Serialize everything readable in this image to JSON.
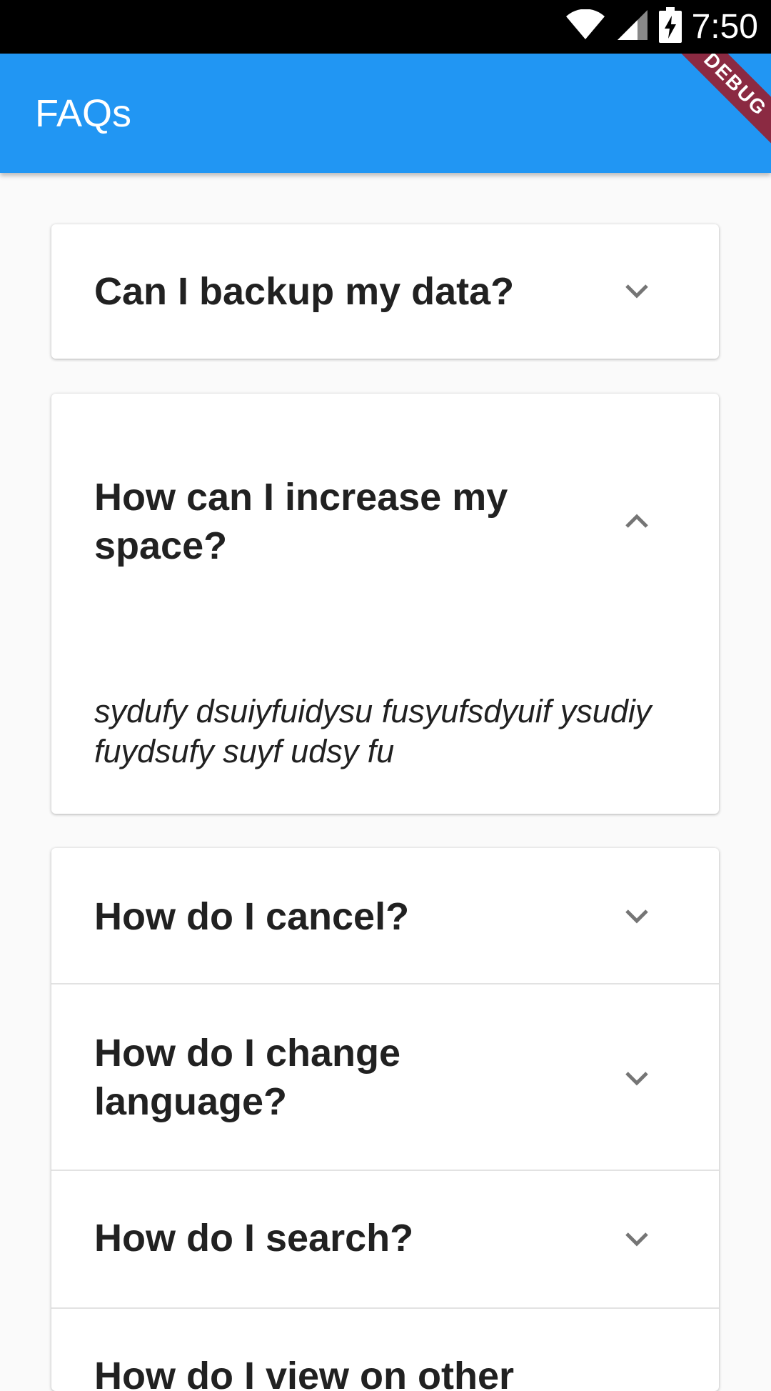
{
  "status_bar": {
    "time": "7:50",
    "icons": [
      "wifi-icon",
      "signal-icon",
      "battery-charging-icon"
    ]
  },
  "app_bar": {
    "title": "FAQs",
    "debug_banner": "DEBUG",
    "color": "#2196f3"
  },
  "faqs": [
    {
      "question": "Can I backup my data?",
      "expanded": false
    },
    {
      "question": "How can I increase my space?",
      "expanded": true,
      "answer": "sydufy dsuiyfuidysu fusyufsdyuif ysudiy fuydsufy suyf udsy fu"
    },
    {
      "question": "How do I cancel?",
      "expanded": false
    },
    {
      "question": "How do I change language?",
      "expanded": false
    },
    {
      "question": "How do I search?",
      "expanded": false
    },
    {
      "question": "How do I view on other",
      "expanded": false
    }
  ]
}
